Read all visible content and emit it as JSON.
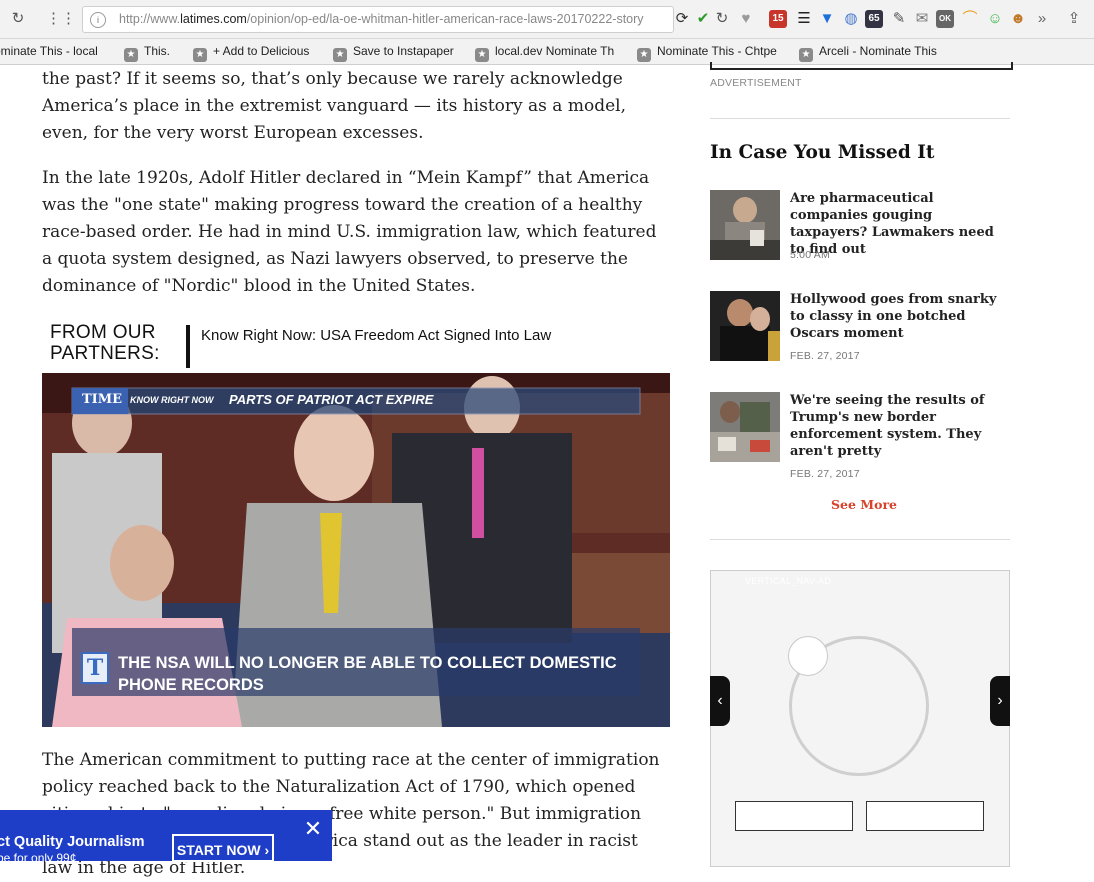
{
  "browser": {
    "url_prefix": "http://www.",
    "url_host": "latimes.com",
    "url_path": "/opinion/op-ed/la-oe-whitman-hitler-american-race-laws-20170222-story",
    "extension_badges": [
      "15",
      "65",
      "OK"
    ],
    "bookmarks": [
      "ominate This - local",
      "This.",
      "+ Add to Delicious",
      "Save to Instapaper",
      "local.dev Nominate Th",
      "Nominate This - Chtpe",
      "Arceli - Nominate This"
    ]
  },
  "article": {
    "para1": "the past? If it seems so, that’s only because we rarely acknowledge America’s place in the extremist vanguard — its history as a model, even, for the very worst European excesses.",
    "para2": "In the late 1920s, Adolf Hitler declared in “Mein Kampf” that America was the \"one state\" making progress toward the creation of a healthy race-based order. He had in mind U.S. immigration law, which featured a quota system designed, as Nazi lawyers observed, to preserve the dominance of \"Nordic\" blood in the United States.",
    "partners_label_1": "FROM OUR",
    "partners_label_2": "PARTNERS:",
    "partner_link": "Know Right Now: USA Freedom Act Signed Into Law",
    "video": {
      "brand": "TIME",
      "tag": "KNOW RIGHT NOW",
      "headline": "PARTS OF PATRIOT ACT EXPIRE",
      "caption_line1": "THE NSA WILL NO LONGER BE ABLE TO COLLECT DOMESTIC",
      "caption_line2": "PHONE RECORDS",
      "logo_letter": "T"
    },
    "para3": "The American commitment to putting race at the center of immigration policy reached back to the Naturalization Act of 1790, which opened citizenship to \"any alien, being a free white person.\" But immigration was only part of what made America stand out as the leader in racist law in the age of Hitler."
  },
  "sidebar": {
    "ad_label": "ADVERTISEMENT",
    "section_title": "In Case You Missed It",
    "items": [
      {
        "title": "Are pharmaceutical companies gouging taxpayers? Lawmakers need to find out",
        "date": "5:00 AM"
      },
      {
        "title": "Hollywood goes from snarky to classy in one botched Oscars moment",
        "date": "FEB. 27, 2017"
      },
      {
        "title": "We're seeing the results of Trump's new border enforcement system. They aren't pretty",
        "date": "FEB. 27, 2017"
      }
    ],
    "see_more": "See More",
    "vertical_label": "VERTICAL_NAV-AD"
  },
  "promo": {
    "title": "ct Quality Journalism",
    "subtitle": "be for only 99¢",
    "button": "START NOW ›"
  }
}
